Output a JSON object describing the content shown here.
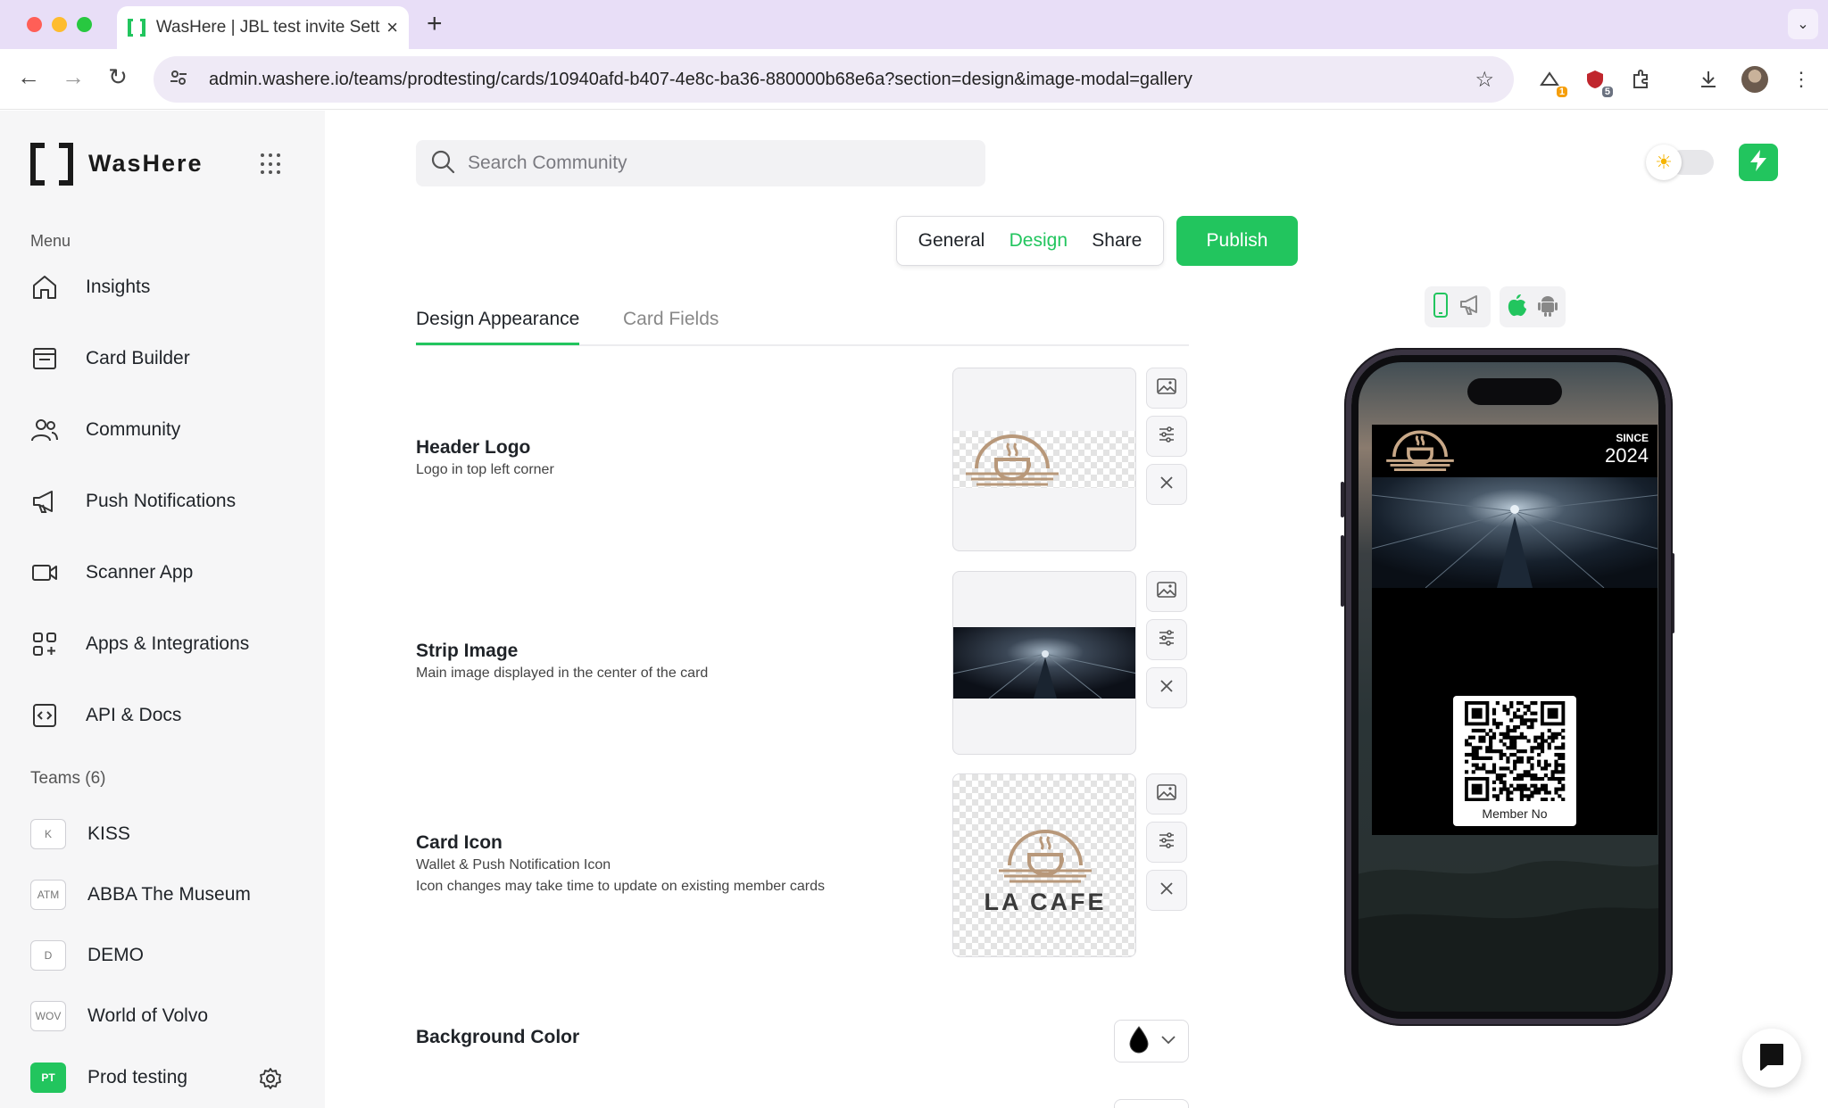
{
  "browser": {
    "tab_title": "WasHere | JBL test invite Sett",
    "url": "admin.washere.io/teams/prodtesting/cards/10940afd-b407-4e8c-ba36-880000b68e6a?section=design&image-modal=gallery",
    "extensions": [
      {
        "name": "extension-1",
        "badge": "1",
        "badge_color": "#f59e0b"
      },
      {
        "name": "extension-2",
        "badge": "5",
        "badge_color": "#6b7280"
      }
    ]
  },
  "sidebar": {
    "brand": "WasHere",
    "menu_label": "Menu",
    "items": [
      {
        "label": "Insights",
        "icon": "home-icon"
      },
      {
        "label": "Card Builder",
        "icon": "card-builder-icon"
      },
      {
        "label": "Community",
        "icon": "users-icon"
      },
      {
        "label": "Push Notifications",
        "icon": "megaphone-icon"
      },
      {
        "label": "Scanner App",
        "icon": "video-icon"
      },
      {
        "label": "Apps & Integrations",
        "icon": "apps-icon"
      },
      {
        "label": "API & Docs",
        "icon": "code-icon"
      }
    ],
    "teams_label": "Teams (6)",
    "teams": [
      {
        "badge": "K",
        "name": "KISS"
      },
      {
        "badge": "ATM",
        "name": "ABBA The Museum"
      },
      {
        "badge": "D",
        "name": "DEMO"
      },
      {
        "badge": "WOV",
        "name": "World of Volvo"
      },
      {
        "badge": "PT",
        "name": "Prod testing",
        "active": true
      }
    ]
  },
  "search": {
    "placeholder": "Search Community"
  },
  "sections": {
    "general": "General",
    "design": "Design",
    "share": "Share",
    "active": "Design"
  },
  "publish_label": "Publish",
  "subtabs": {
    "appearance": "Design Appearance",
    "fields": "Card Fields"
  },
  "fields": {
    "header_logo": {
      "title": "Header Logo",
      "desc": "Logo in top left corner"
    },
    "strip_image": {
      "title": "Strip Image",
      "desc": "Main image displayed in the center of the card"
    },
    "card_icon": {
      "title": "Card Icon",
      "desc1": "Wallet & Push Notification Icon",
      "desc2": "Icon changes may take time to update on existing member cards",
      "logo_text": "LA CAFE"
    },
    "background_color": {
      "title": "Background Color",
      "value": "#000000"
    }
  },
  "preview": {
    "since_label": "SINCE",
    "since_value": "2024",
    "qr_caption": "Member No"
  },
  "colors": {
    "accent": "#22c55e",
    "logo_brown": "#b8987a"
  }
}
